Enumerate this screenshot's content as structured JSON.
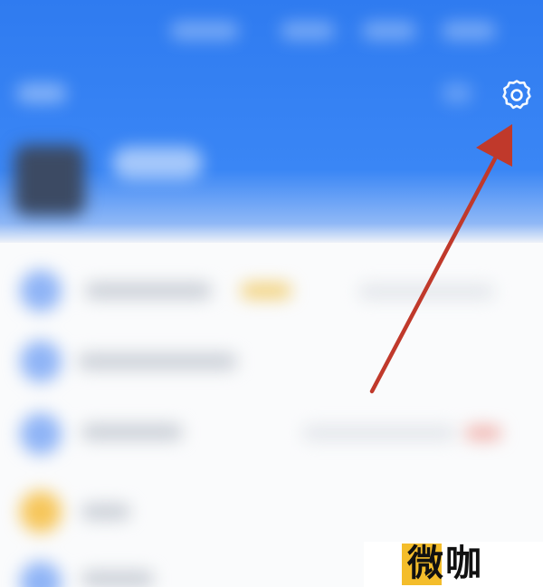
{
  "header": {
    "settings_icon": "gear-icon"
  },
  "annotation": {
    "arrow_color": "#c0392b",
    "target": "settings"
  },
  "watermark": {
    "text": "微咖",
    "accent_color": "#f4bd2b"
  },
  "colors": {
    "header_blue": "#2f7bf0",
    "background": "#fafbfc"
  }
}
